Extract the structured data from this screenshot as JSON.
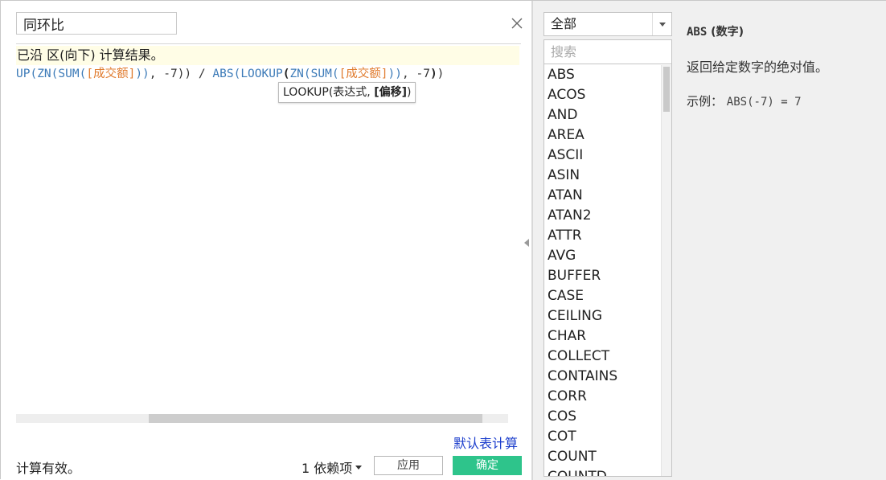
{
  "editor": {
    "calc_name": "同环比",
    "hint": "已沿 区(向下) 计算结果。",
    "code": [
      {
        "text": "UP",
        "style": "fn"
      },
      {
        "text": "(",
        "style": "fn"
      },
      {
        "text": "ZN",
        "style": "fn"
      },
      {
        "text": "(",
        "style": "fn"
      },
      {
        "text": "SUM",
        "style": "fn"
      },
      {
        "text": "(",
        "style": "fn"
      },
      {
        "text": "[成交额]",
        "style": "fld"
      },
      {
        "text": "))",
        "style": "fn"
      },
      {
        "text": ", -7))",
        "style": "plain"
      },
      {
        "text": " / ",
        "style": "plain"
      },
      {
        "text": "ABS",
        "style": "fn"
      },
      {
        "text": "(",
        "style": "fn"
      },
      {
        "text": "LOOKUP",
        "style": "fn"
      },
      {
        "text": "(",
        "style": "bold"
      },
      {
        "text": "ZN",
        "style": "fn"
      },
      {
        "text": "(",
        "style": "fn"
      },
      {
        "text": "SUM",
        "style": "fn"
      },
      {
        "text": "(",
        "style": "fn"
      },
      {
        "text": "[成交额]",
        "style": "fld"
      },
      {
        "text": "))",
        "style": "fn"
      },
      {
        "text": ", -7",
        "style": "plain"
      },
      {
        "text": ")",
        "style": "bold"
      },
      {
        "text": ")",
        "style": "plain"
      }
    ],
    "tooltip": {
      "prefix": "LOOKUP(表达式, ",
      "bold": "[偏移]",
      "suffix": ")"
    }
  },
  "footer": {
    "default_table_calc": "默认表计算",
    "status": "计算有效。",
    "dependencies": "1 依赖项",
    "apply": "应用",
    "ok": "确定"
  },
  "functions": {
    "category": "全部",
    "search_placeholder": "搜索",
    "items": [
      "ABS",
      "ACOS",
      "AND",
      "AREA",
      "ASCII",
      "ASIN",
      "ATAN",
      "ATAN2",
      "ATTR",
      "AVG",
      "BUFFER",
      "CASE",
      "CEILING",
      "CHAR",
      "COLLECT",
      "CONTAINS",
      "CORR",
      "COS",
      "COT",
      "COUNT",
      "COUNTD"
    ]
  },
  "description": {
    "fn_name": "ABS",
    "fn_arg": "(数字)",
    "text": "返回给定数字的绝对值。",
    "example_label": "示例：",
    "example_code": "ABS(-7) = 7"
  },
  "colors": {
    "accent_ok": "#2ec48b",
    "function": "#3d7bb8",
    "field": "#e07b2e",
    "link": "#1a3ccc"
  }
}
